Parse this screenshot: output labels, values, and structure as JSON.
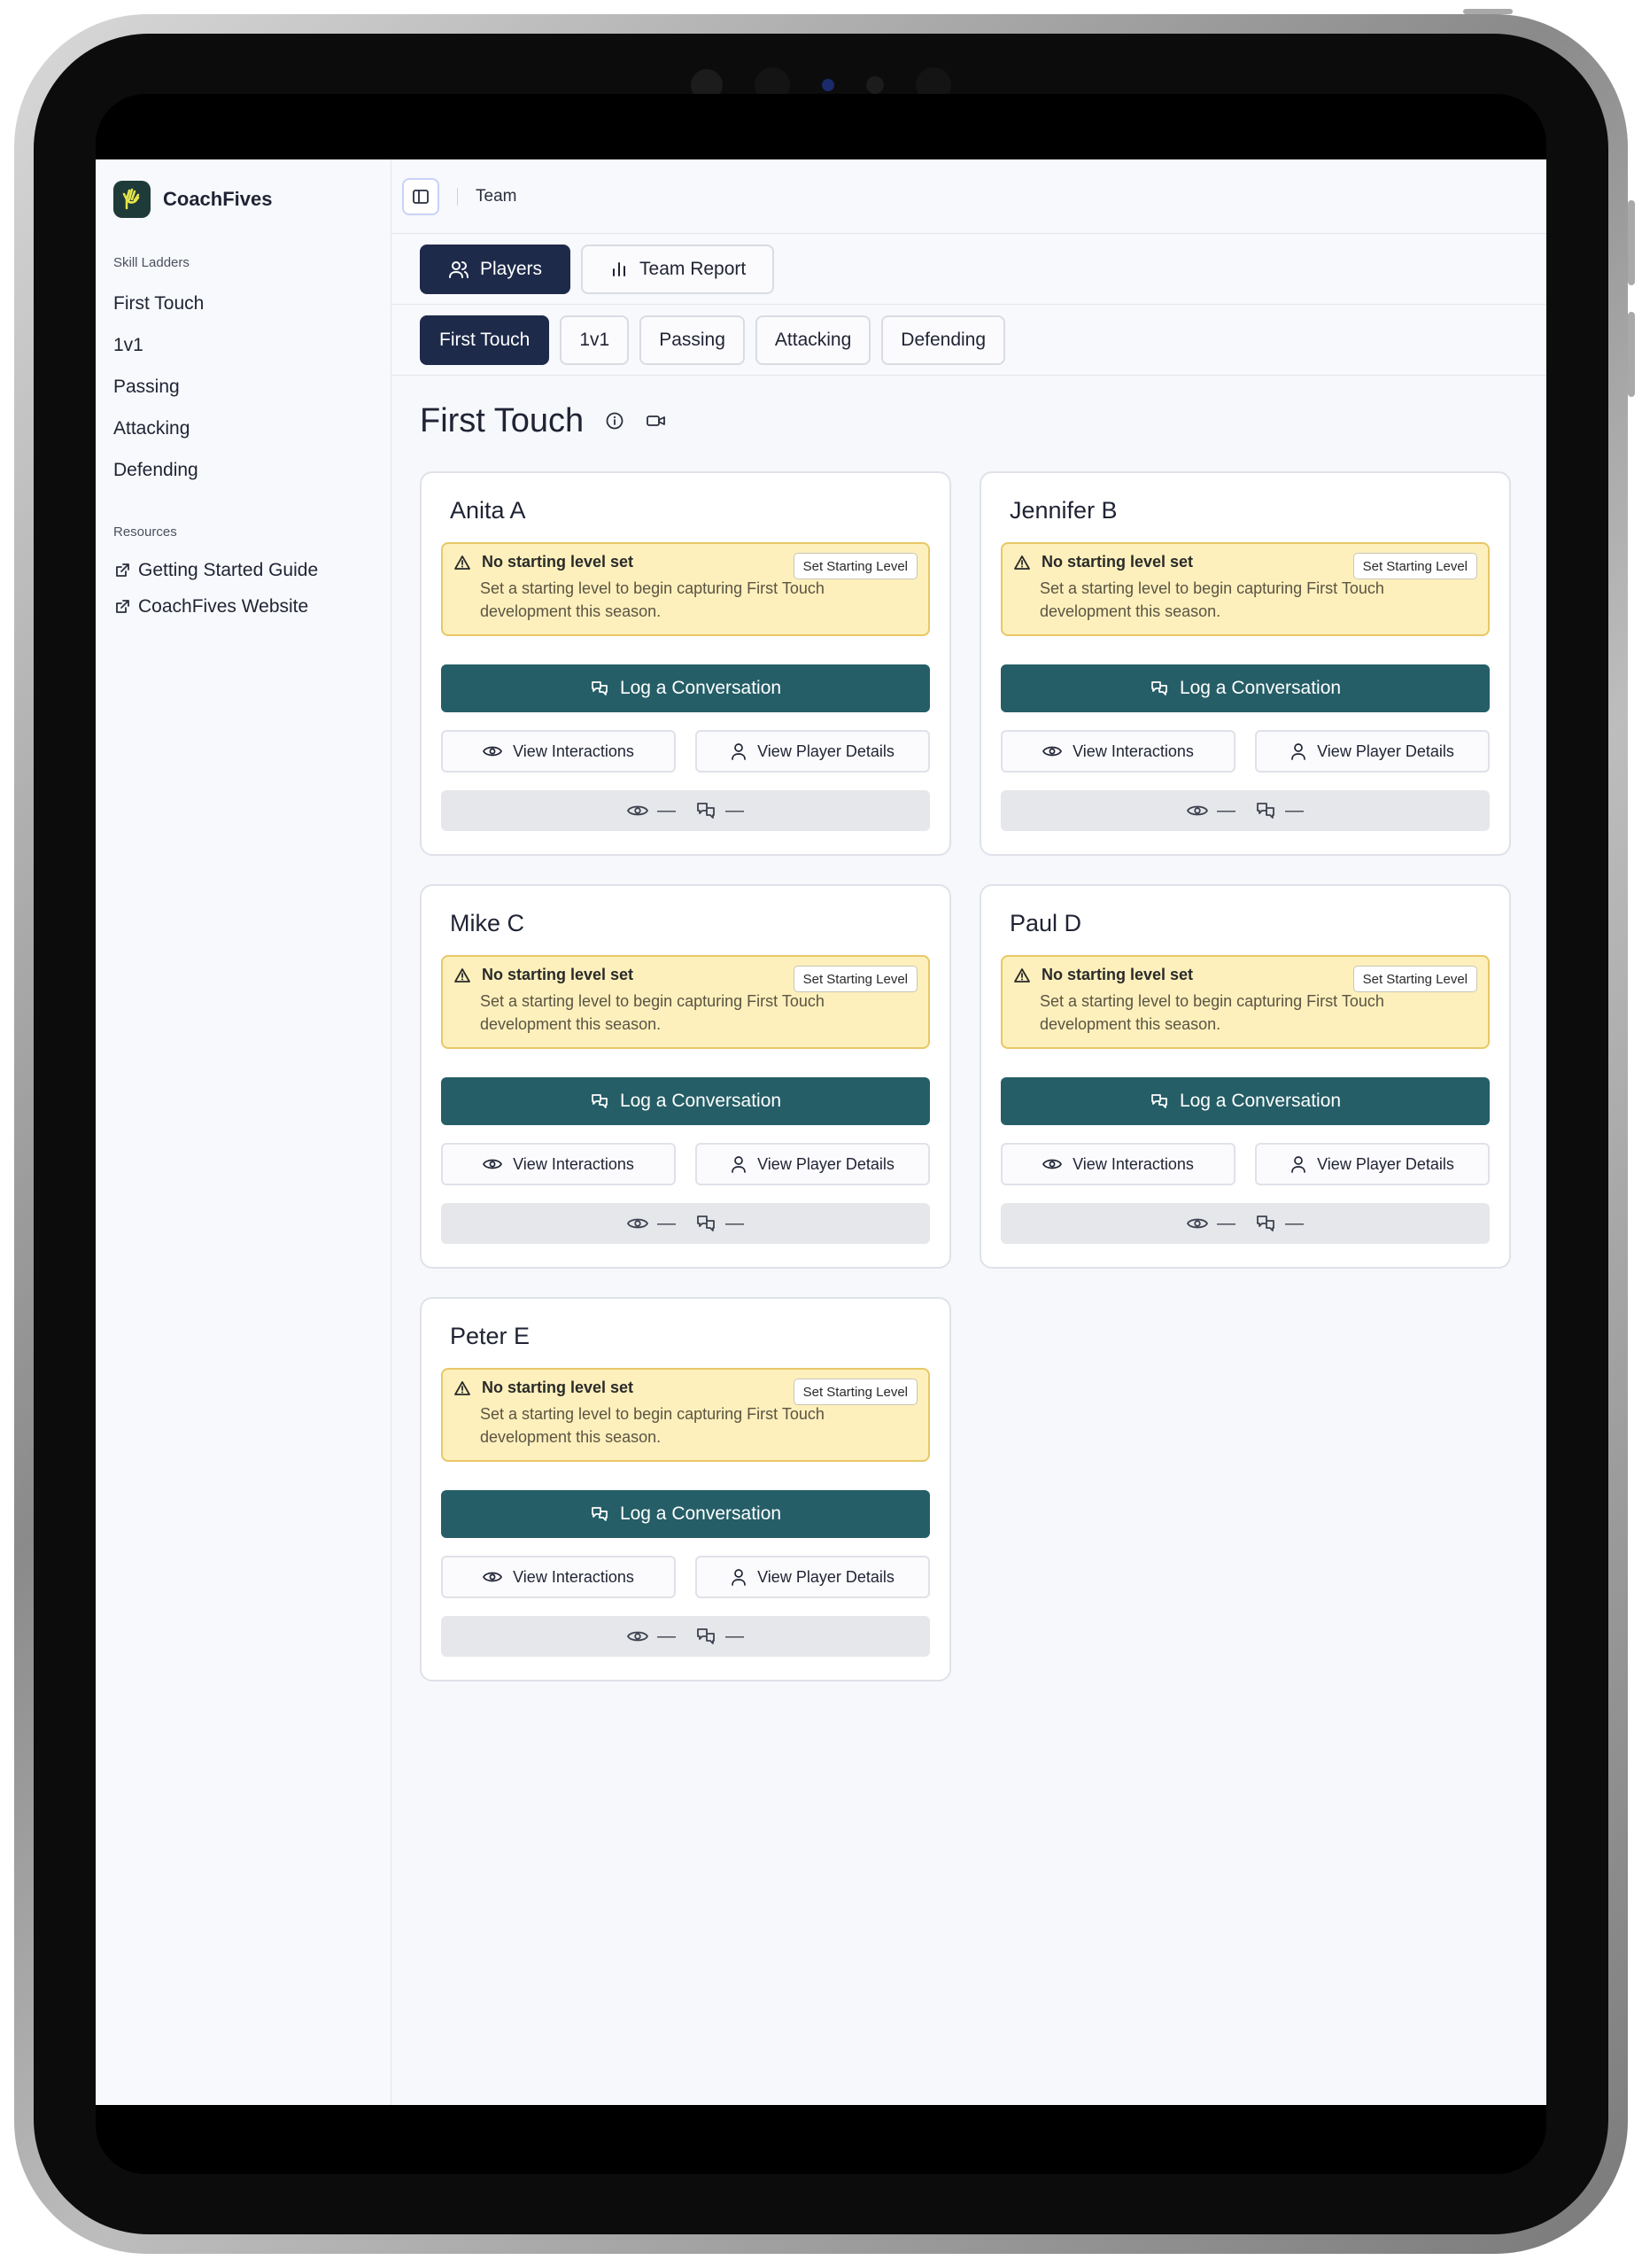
{
  "app": {
    "brand": "CoachFives",
    "brand_color": "#1f3b39",
    "accent_color": "#255e67",
    "navy_color": "#1e2a4a"
  },
  "sidebar": {
    "skill_ladders_label": "Skill Ladders",
    "skill_items": [
      {
        "label": "First Touch"
      },
      {
        "label": "1v1"
      },
      {
        "label": "Passing"
      },
      {
        "label": "Attacking"
      },
      {
        "label": "Defending"
      }
    ],
    "resources_label": "Resources",
    "resources": [
      {
        "label": "Getting Started Guide",
        "icon": "external-link-icon"
      },
      {
        "label": "CoachFives Website",
        "icon": "external-link-icon"
      }
    ]
  },
  "topbar": {
    "breadcrumb": "Team"
  },
  "view_tabs": [
    {
      "label": "Players",
      "icon": "users-icon",
      "active": true
    },
    {
      "label": "Team Report",
      "icon": "bar-chart-icon",
      "active": false
    }
  ],
  "skill_tabs": [
    {
      "label": "First Touch",
      "active": true
    },
    {
      "label": "1v1",
      "active": false
    },
    {
      "label": "Passing",
      "active": false
    },
    {
      "label": "Attacking",
      "active": false
    },
    {
      "label": "Defending",
      "active": false
    }
  ],
  "page": {
    "title": "First Touch"
  },
  "card_labels": {
    "alert_title": "No starting level set",
    "alert_body": "Set a starting level to begin capturing First Touch development this season.",
    "set_level": "Set Starting Level",
    "log_conversation": "Log a Conversation",
    "view_interactions": "View Interactions",
    "view_player_details": "View Player Details",
    "stat_views": "—",
    "stat_conversations": "—"
  },
  "players": [
    {
      "name": "Anita A"
    },
    {
      "name": "Jennifer B"
    },
    {
      "name": "Mike C"
    },
    {
      "name": "Paul D"
    },
    {
      "name": "Peter E"
    }
  ]
}
